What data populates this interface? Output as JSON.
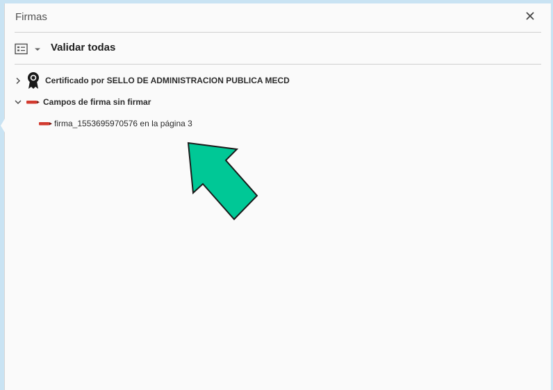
{
  "panel": {
    "title": "Firmas",
    "close_icon": "close-icon"
  },
  "toolbar": {
    "options_icon": "signature-options-icon",
    "dropdown_icon": "caret-down-icon",
    "validate_label": "Validar todas"
  },
  "tree": {
    "certificate": {
      "label": "Certificado por SELLO DE ADMINISTRACION PUBLICA MECD",
      "icon": "certificate-ribbon-icon",
      "expanded": false
    },
    "unsigned_group": {
      "label": "Campos de firma sin firmar",
      "icon": "signature-field-icon",
      "expanded": true,
      "items": [
        {
          "label": "firma_1553695970576 en la página 3",
          "icon": "signature-field-icon"
        }
      ]
    }
  },
  "annotation": {
    "arrow_color": "#00c896",
    "arrow_icon": "pointer-arrow-icon"
  },
  "colors": {
    "panel_bg": "#fafafa",
    "outer_bg": "#c9e3f3",
    "signature_red": "#d23a2f"
  }
}
